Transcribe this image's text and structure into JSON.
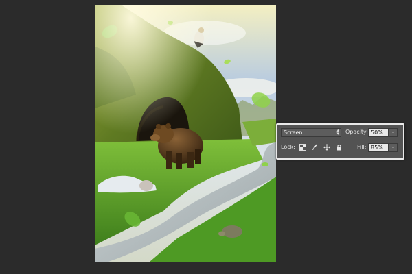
{
  "layers_panel": {
    "blend_mode": "Screen",
    "opacity_label": "Opacity:",
    "opacity_value": "50%",
    "lock_label": "Lock:",
    "fill_label": "Fill:",
    "fill_value": "85%",
    "lock_icons": [
      "lock-transparent-pixels-icon",
      "lock-image-pixels-icon",
      "lock-position-icon",
      "lock-all-icon"
    ]
  },
  "colors": {
    "workspace_bg": "#2b2b2b",
    "panel_bg": "#535353",
    "panel_border": "#e9e9e9"
  }
}
